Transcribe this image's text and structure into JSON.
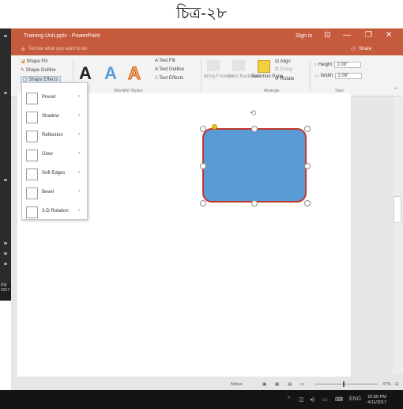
{
  "caption": "চিত্র-২৮",
  "window": {
    "title": "Training Unit.pptx - PowerPoint",
    "sign_in": "Sign in",
    "controls": [
      "⊡",
      "—",
      "❐",
      "✕"
    ]
  },
  "tellbar": {
    "placeholder": "Tell me what you want to do",
    "share": "Share"
  },
  "ribbon": {
    "shape_styles": {
      "fill": "Shape Fill",
      "outline": "Shape Outline",
      "effects": "Shape Effects"
    },
    "wordart": {
      "letters": [
        "A",
        "A",
        "A"
      ],
      "text_fill": "Text Fill",
      "text_outline": "Text Outline",
      "text_effects": "Text Effects",
      "group_label": "WordArt Styles"
    },
    "arrange": {
      "bring_forward": "Bring Forward",
      "send_backward": "Send Backward",
      "selection_pane": "Selection Pane",
      "align": "Align",
      "group": "Group",
      "rotate": "Rotate",
      "group_label": "Arrange"
    },
    "size": {
      "height_label": "Height:",
      "height_value": "2.08\"",
      "width_label": "Width:",
      "width_value": "2.08\"",
      "group_label": "Size"
    }
  },
  "menu": {
    "items": [
      {
        "label": "Preset"
      },
      {
        "label": "Shadow"
      },
      {
        "label": "Reflection"
      },
      {
        "label": "Glow"
      },
      {
        "label": "Soft Edges"
      },
      {
        "label": "Bevel"
      },
      {
        "label": "3-D Rotation"
      }
    ]
  },
  "slide": {
    "shape_fill": "#5b9bd5",
    "shape_outline": "#c0392b"
  },
  "statusbar": {
    "notes": "Notes",
    "zoom": "47%"
  },
  "taskbar": {
    "time": "10:56 PM",
    "date": "4/11/2017"
  },
  "left_clock": {
    "time": "PM",
    "date": "2017"
  },
  "colors": {
    "accent": "#c65a3c"
  }
}
